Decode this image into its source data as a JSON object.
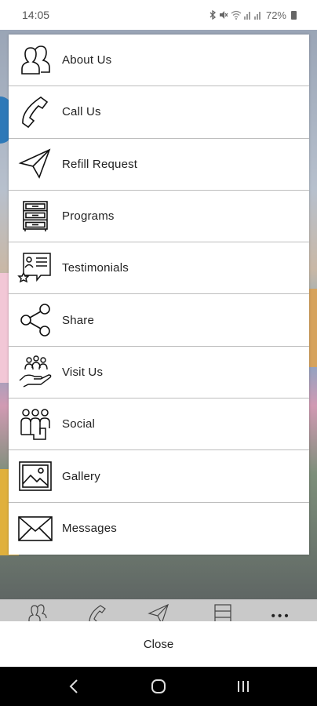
{
  "status_bar": {
    "time": "14:05",
    "battery": "72%",
    "icons": [
      "bluetooth-icon",
      "mute-icon",
      "wifi-icon",
      "signal-icon",
      "battery-icon"
    ]
  },
  "menu": {
    "items": [
      {
        "label": "About Us",
        "icon": "people-icon"
      },
      {
        "label": "Call Us",
        "icon": "phone-icon"
      },
      {
        "label": "Refill Request",
        "icon": "send-icon"
      },
      {
        "label": "Programs",
        "icon": "cabinet-icon"
      },
      {
        "label": "Testimonials",
        "icon": "testimonial-icon"
      },
      {
        "label": "Share",
        "icon": "share-icon"
      },
      {
        "label": "Visit Us",
        "icon": "hand-people-icon"
      },
      {
        "label": "Social",
        "icon": "social-icon"
      },
      {
        "label": "Gallery",
        "icon": "picture-icon"
      },
      {
        "label": "Messages",
        "icon": "envelope-icon"
      }
    ]
  },
  "close_label": "Close",
  "colors": {
    "tabbar": "#c9c9c9",
    "nav_bar": "#000000",
    "divider": "#bdbdbd"
  }
}
